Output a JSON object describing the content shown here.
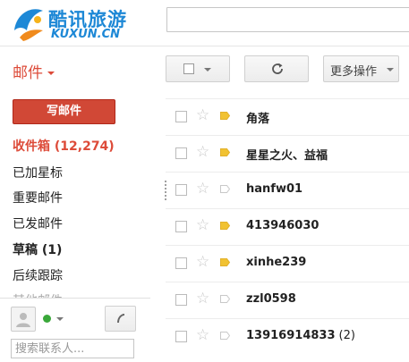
{
  "brand": {
    "name_cn": "酷讯旅游",
    "name_en": "KUXUN.CN",
    "color": "#1d88d6"
  },
  "search": {
    "placeholder": ""
  },
  "mail_menu": {
    "label": "邮件"
  },
  "toolbar": {
    "more_label": "更多操作"
  },
  "compose": {
    "label": "写邮件"
  },
  "nav": {
    "inbox": "收件箱 (12,274)",
    "starred": "已加星标",
    "important": "重要邮件",
    "sent": "已发邮件",
    "drafts": "草稿 (1)",
    "follow_up": "后续跟踪",
    "cut_item": "其他邮件"
  },
  "contacts": {
    "search_placeholder": "搜索联系人..."
  },
  "messages": [
    {
      "sender": "角落",
      "count": "",
      "important": true
    },
    {
      "sender": "星星之火、益福",
      "count": "",
      "important": true
    },
    {
      "sender": "hanfw01",
      "count": "",
      "important": false
    },
    {
      "sender": "413946030",
      "count": "",
      "important": true
    },
    {
      "sender": "xinhe239",
      "count": "",
      "important": true
    },
    {
      "sender": "zzl0598",
      "count": "",
      "important": false
    },
    {
      "sender": "13916914833",
      "count": "(2)",
      "important": false
    }
  ],
  "colors": {
    "accent": "#dd4b39",
    "compose_bg": "#d14836",
    "important_tag": "#f1c232"
  }
}
